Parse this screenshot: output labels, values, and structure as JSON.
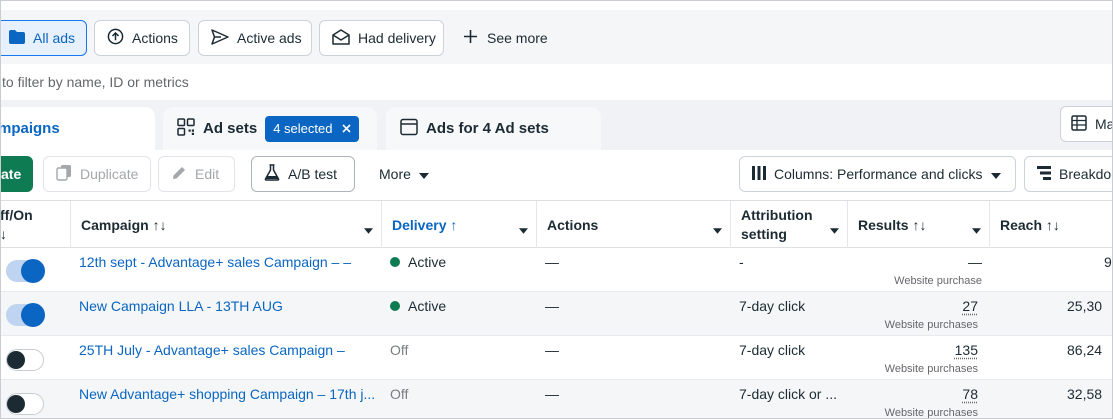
{
  "filters": {
    "all_ads": "All ads",
    "actions": "Actions",
    "active_ads": "Active ads",
    "had_delivery": "Had delivery",
    "see_more": "See more"
  },
  "search": {
    "placeholder": "to filter by name, ID or metrics"
  },
  "tabs": {
    "campaigns": "mpaigns",
    "ad_sets": "Ad sets",
    "selected_chip": "4 selected",
    "ads": "Ads for 4 Ad sets",
    "right_button": "Ma"
  },
  "toolbar": {
    "create": "ate",
    "duplicate": "Duplicate",
    "edit": "Edit",
    "ab_test": "A/B test",
    "more": "More",
    "columns": "Columns: Performance and clicks",
    "breakdown": "Breakdo"
  },
  "columns": {
    "off_on_1": "ff/On",
    "off_on_2": "↓",
    "campaign": "Campaign ↑↓",
    "delivery": "Delivery ↑",
    "actions": "Actions",
    "attribution_1": "Attribution",
    "attribution_2": "setting",
    "results": "Results ↑↓",
    "reach": "Reach ↑↓"
  },
  "rows": [
    {
      "toggle": "on",
      "campaign": "12th sept - Advantage+ sales Campaign – –",
      "delivery": "Active",
      "actions": "—",
      "attribution": "-",
      "results": "—",
      "results_sub": "Website purchase",
      "reach": "9"
    },
    {
      "toggle": "on",
      "campaign": "New Campaign LLA - 13TH AUG",
      "delivery": "Active",
      "actions": "—",
      "attribution": "7-day click",
      "results": "27",
      "results_sub": "Website purchases",
      "reach": "25,30"
    },
    {
      "toggle": "off",
      "campaign": "25TH July - Advantage+ sales Campaign –",
      "delivery": "Off",
      "actions": "—",
      "attribution": "7-day click",
      "results": "135",
      "results_sub": "Website purchases",
      "reach": "86,24"
    },
    {
      "toggle": "off",
      "campaign": "New Advantage+ shopping Campaign – 17th j...",
      "delivery": "Off",
      "actions": "—",
      "attribution": "7-day click or ...",
      "results": "78",
      "results_sub": "Website purchases",
      "reach": "32,58"
    }
  ],
  "colors": {
    "accent": "#0a66c2",
    "create_green": "#0f7b52",
    "active_dot": "#0f7b52"
  }
}
